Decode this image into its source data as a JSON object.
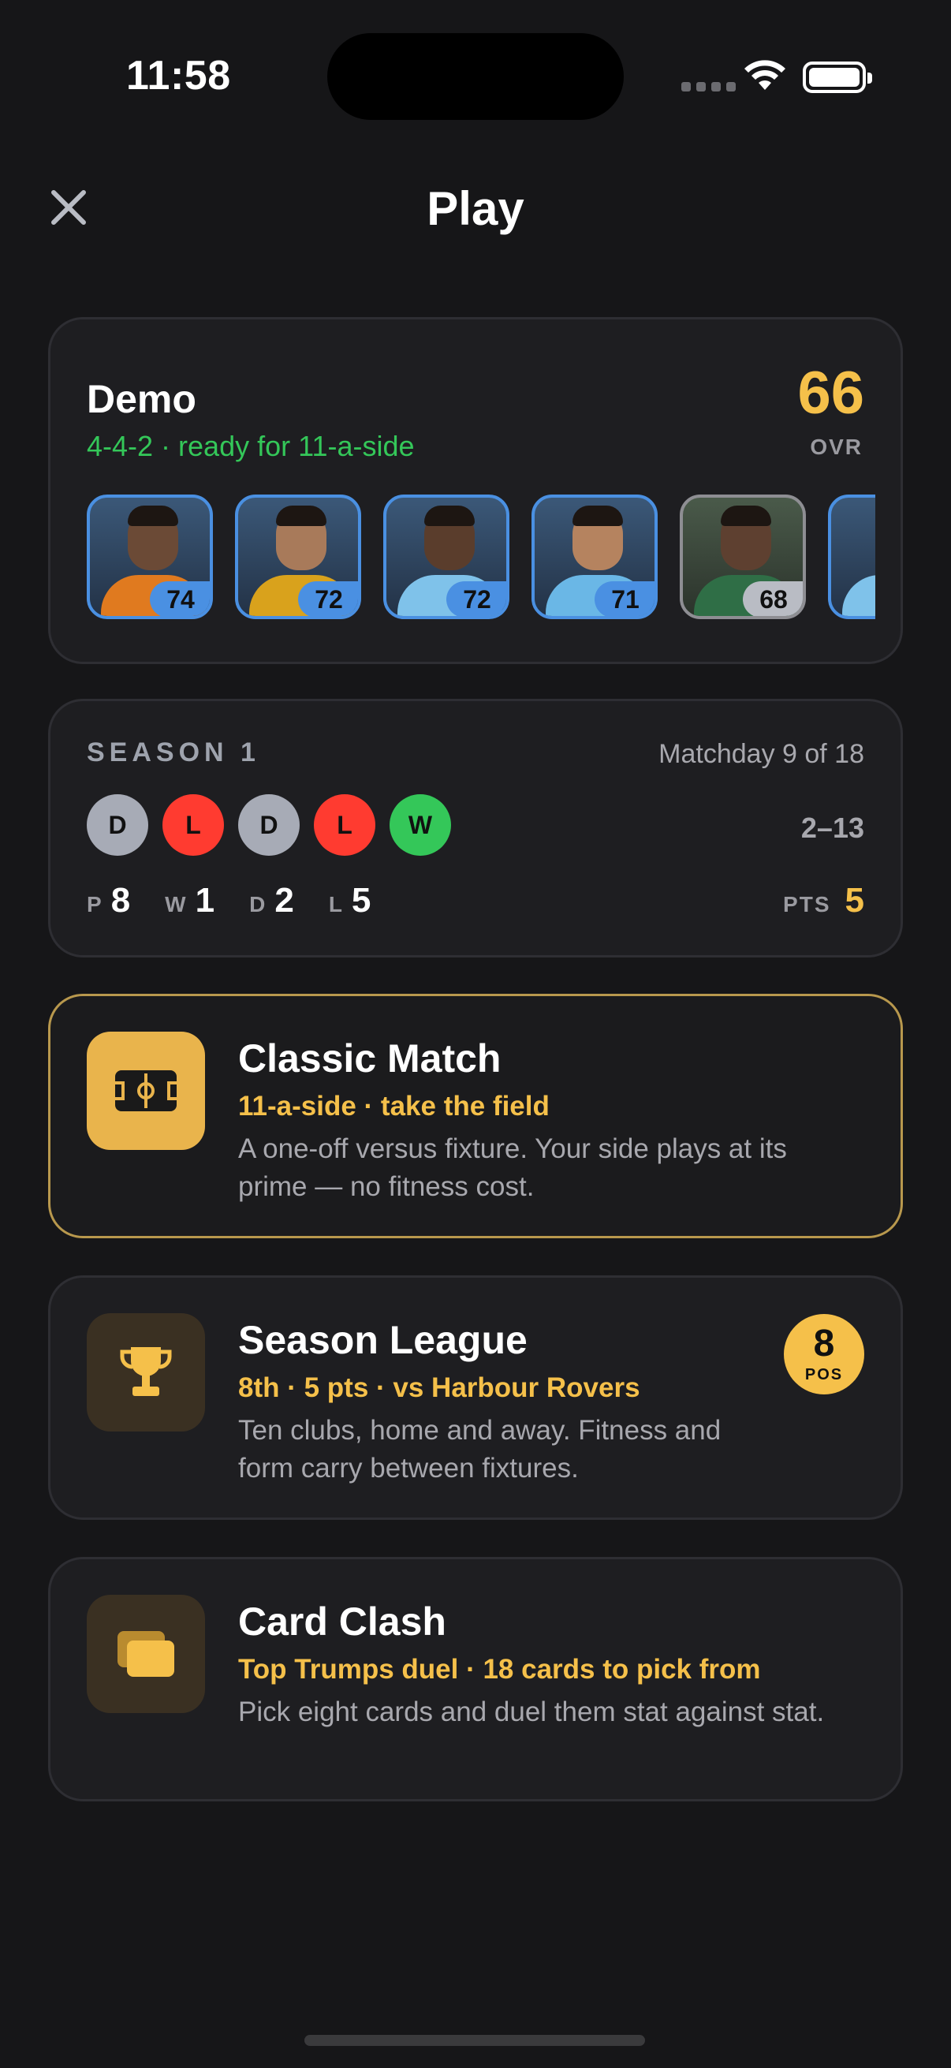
{
  "status": {
    "time": "11:58"
  },
  "header": {
    "title": "Play"
  },
  "team": {
    "name": "Demo",
    "formation": "4-4-2 · ready for 11-a-side",
    "ovr": "66",
    "ovr_label": "OVR",
    "players": [
      {
        "rating": "74",
        "tier": "blue",
        "kit": "#e07a1f"
      },
      {
        "rating": "72",
        "tier": "blue",
        "kit": "#d9a21c"
      },
      {
        "rating": "72",
        "tier": "blue",
        "kit": "#7fc2ea"
      },
      {
        "rating": "71",
        "tier": "blue",
        "kit": "#6ab7e6"
      },
      {
        "rating": "68",
        "tier": "gray",
        "kit": "#2f6e46"
      }
    ]
  },
  "season": {
    "label": "SEASON 1",
    "matchday": "Matchday 9 of 18",
    "form": [
      "D",
      "L",
      "D",
      "L",
      "W"
    ],
    "score": "2–13",
    "stats": [
      {
        "key": "P",
        "value": "8"
      },
      {
        "key": "W",
        "value": "1"
      },
      {
        "key": "D",
        "value": "2"
      },
      {
        "key": "L",
        "value": "5"
      }
    ],
    "pts_label": "PTS",
    "pts_value": "5"
  },
  "modes": {
    "classic": {
      "title": "Classic Match",
      "subtitle": "11-a-side · take the field",
      "description": "A one-off versus fixture. Your side plays at its prime — no fitness cost.",
      "icon": "pitch-icon"
    },
    "league": {
      "title": "Season League",
      "subtitle": "8th · 5 pts · vs Harbour Rovers",
      "description": "Ten clubs, home and away. Fitness and form carry between fixtures.",
      "icon": "trophy-icon",
      "pos_value": "8",
      "pos_label": "POS"
    },
    "clash": {
      "title": "Card Clash",
      "subtitle": "Top Trumps duel · 18 cards to pick from",
      "description": "Pick eight cards and duel them stat against stat.",
      "icon": "cards-icon"
    }
  },
  "colors": {
    "background": "#161618",
    "accent_gold": "#f5c04a",
    "win": "#34c759",
    "loss": "#ff3b30",
    "draw": "#a7abb6",
    "rating_blue": "#4a90e2"
  }
}
